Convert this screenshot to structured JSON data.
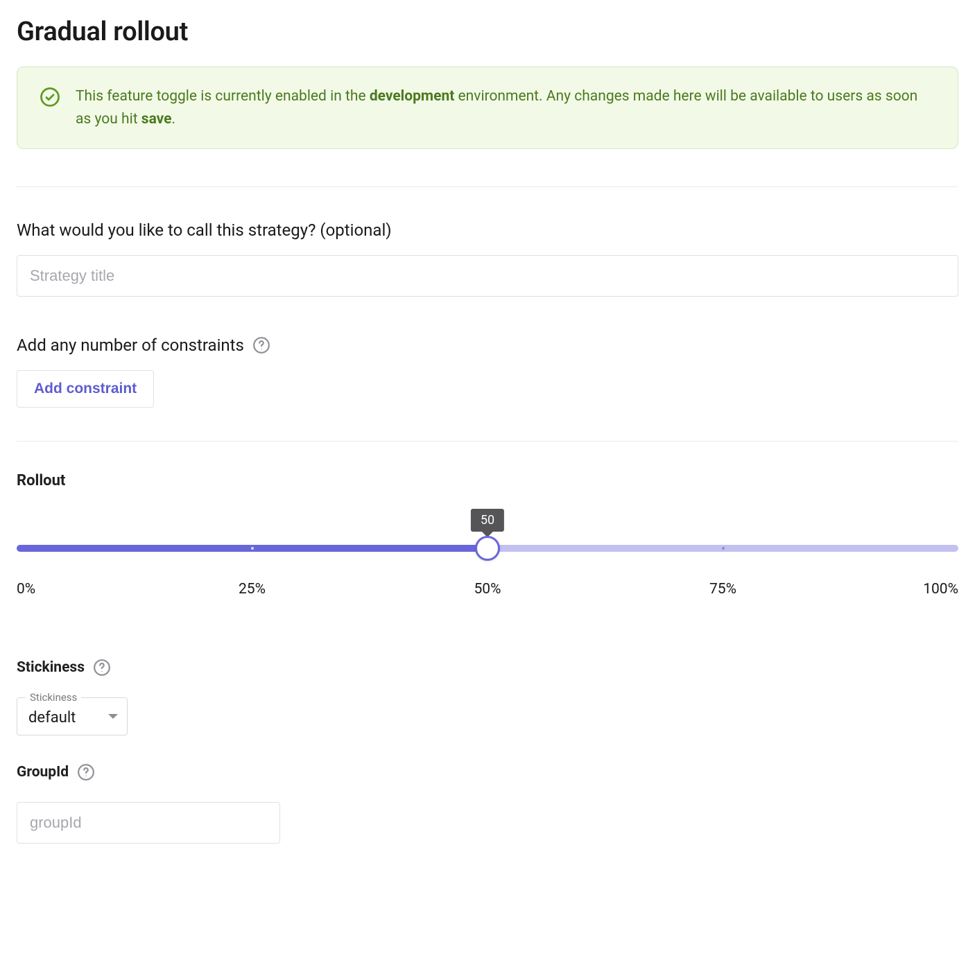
{
  "title": "Gradual rollout",
  "alert": {
    "prefix": "This feature toggle is currently enabled in the ",
    "env": "development",
    "mid": " environment. Any changes made here will be available to users as soon as you hit ",
    "action": "save",
    "suffix": "."
  },
  "strategy_name": {
    "label": "What would you like to call this strategy? (optional)",
    "placeholder": "Strategy title",
    "value": ""
  },
  "constraints": {
    "label": "Add any number of constraints",
    "button": "Add constraint"
  },
  "rollout": {
    "label": "Rollout",
    "value": 50,
    "tooltip": "50",
    "ticks": [
      "0%",
      "25%",
      "50%",
      "75%",
      "100%"
    ]
  },
  "stickiness": {
    "label": "Stickiness",
    "legend": "Stickiness",
    "value": "default"
  },
  "group": {
    "label": "GroupId",
    "placeholder": "groupId",
    "value": ""
  },
  "colors": {
    "accent": "#6a66d9",
    "success": "#4a7a1f"
  }
}
